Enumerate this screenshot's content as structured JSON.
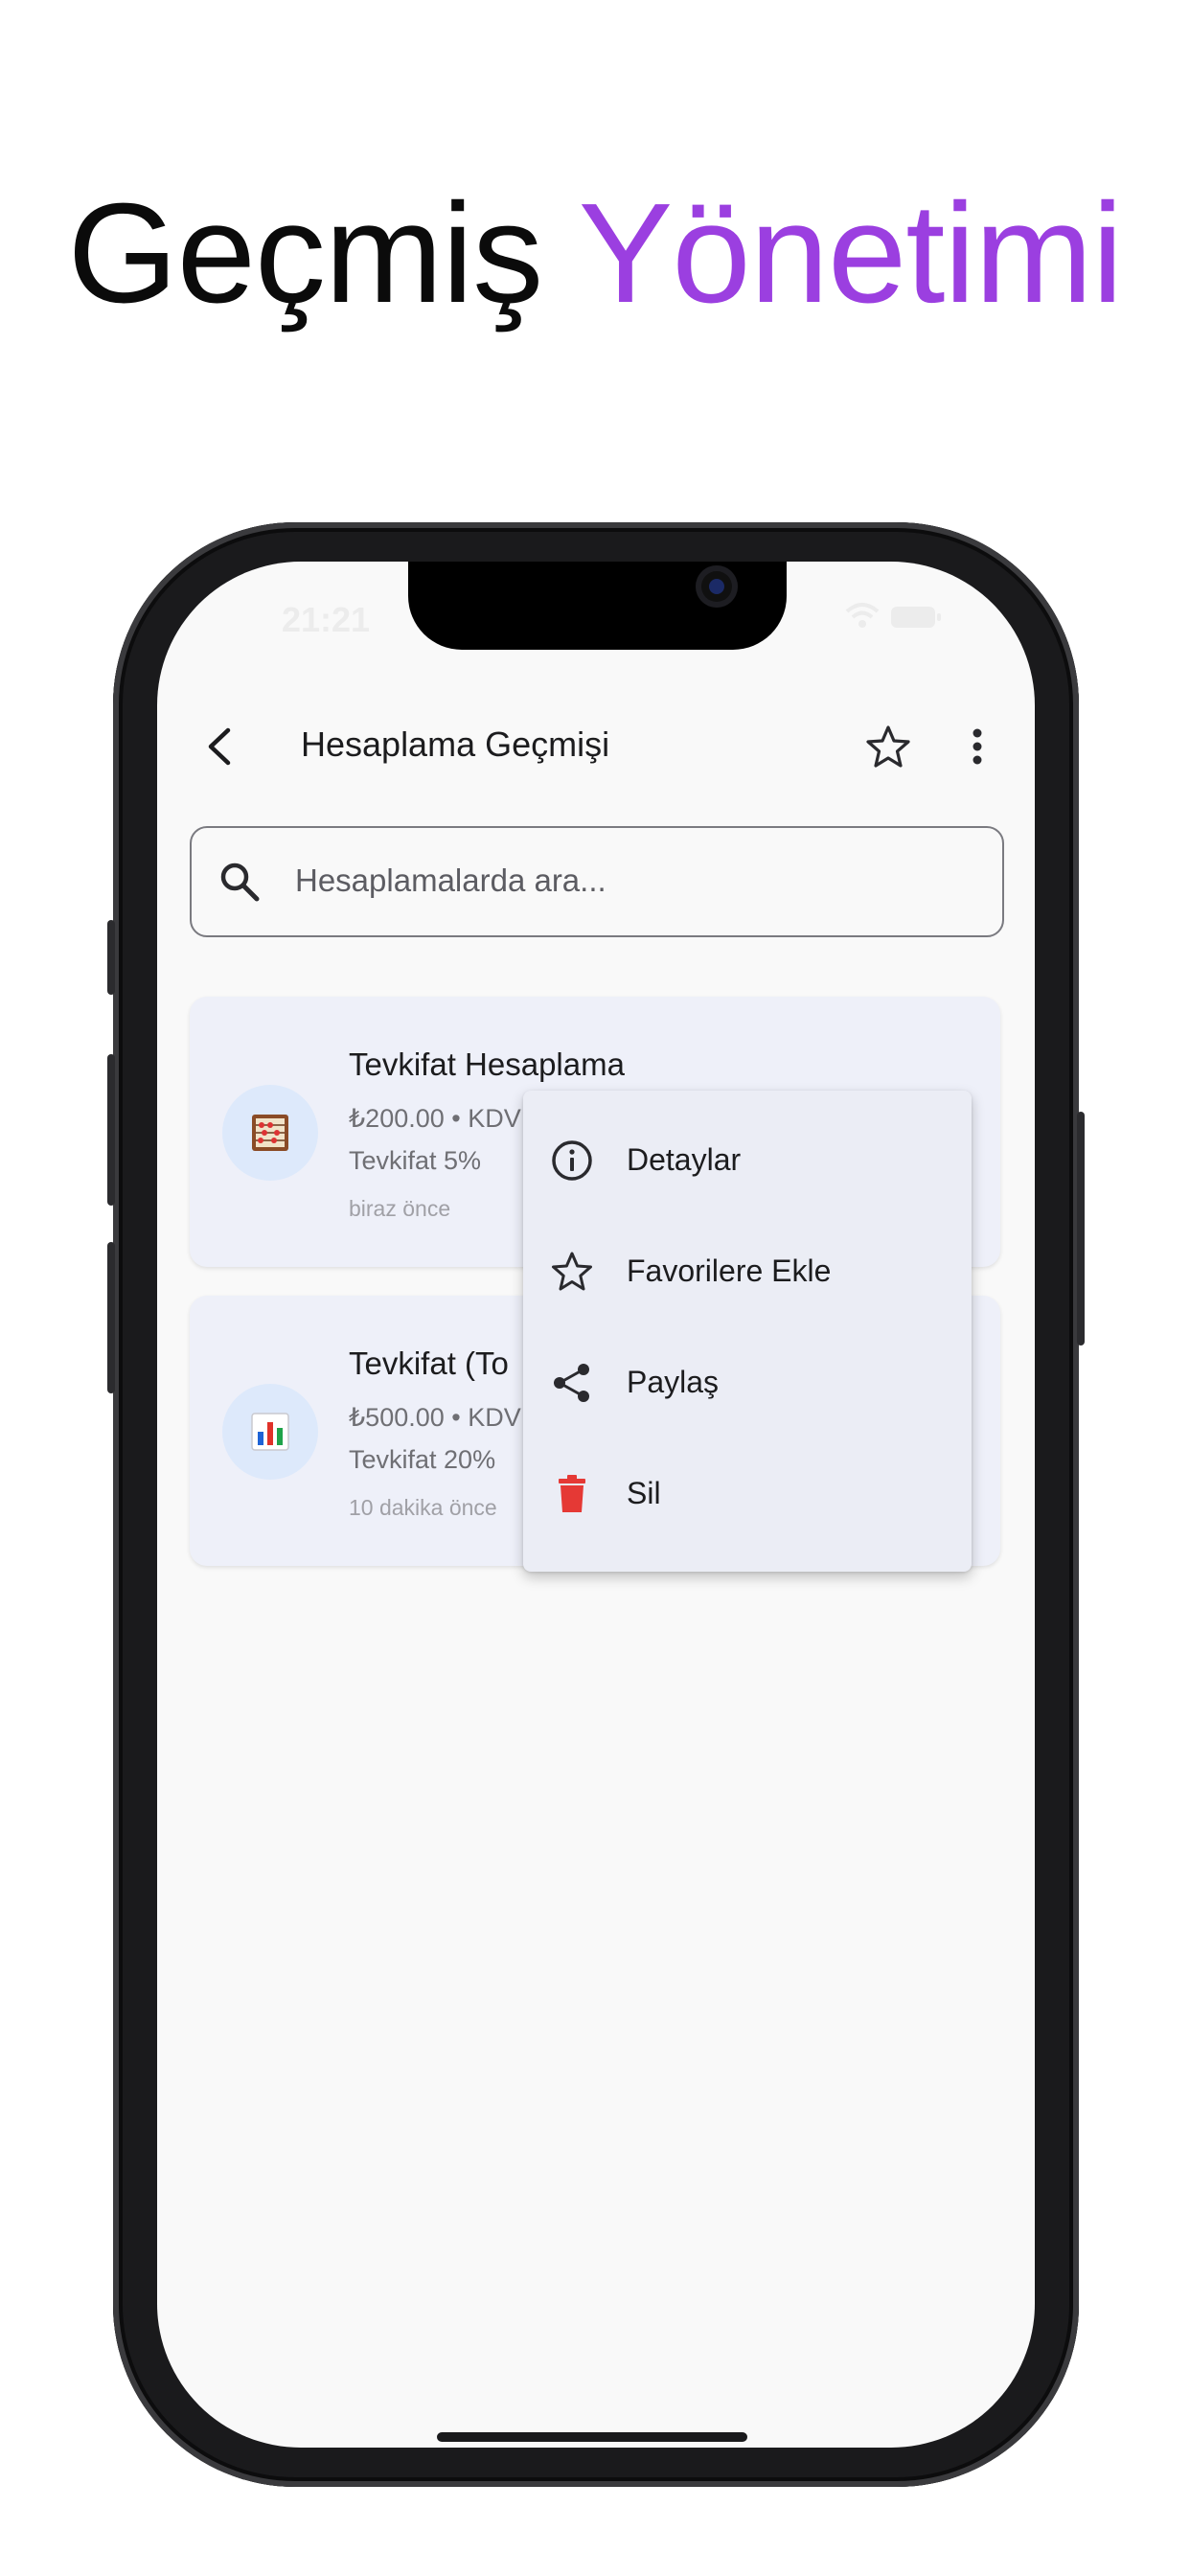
{
  "headline": {
    "part1": "Geçmiş",
    "part2": "Yönetimi"
  },
  "colors": {
    "accent": "#9b3fe0",
    "delete": "#e53935",
    "card_bg": "#eef0f9"
  },
  "status_bar": {
    "time": "21:21"
  },
  "appbar": {
    "title": "Hesaplama Geçmişi",
    "icons": [
      "back-arrow-icon",
      "star-outline-icon",
      "more-vert-icon"
    ]
  },
  "search": {
    "placeholder": "Hesaplamalarda ara..."
  },
  "history": [
    {
      "title": "Tevkifat Hesaplama",
      "amount_line": "₺200.00 • KDV",
      "rate_line": "Tevkifat 5%",
      "time": "biraz önce",
      "icon": "abacus-icon"
    },
    {
      "title": "Tevkifat (To",
      "amount_line": "₺500.00 • KDV",
      "rate_line": "Tevkifat 20%",
      "time": "10 dakika önce",
      "icon": "bar-chart-icon"
    }
  ],
  "context_menu": [
    {
      "label": "Detaylar",
      "icon": "info-icon"
    },
    {
      "label": "Favorilere Ekle",
      "icon": "star-outline-icon"
    },
    {
      "label": "Paylaş",
      "icon": "share-icon"
    },
    {
      "label": "Sil",
      "icon": "trash-icon"
    }
  ]
}
